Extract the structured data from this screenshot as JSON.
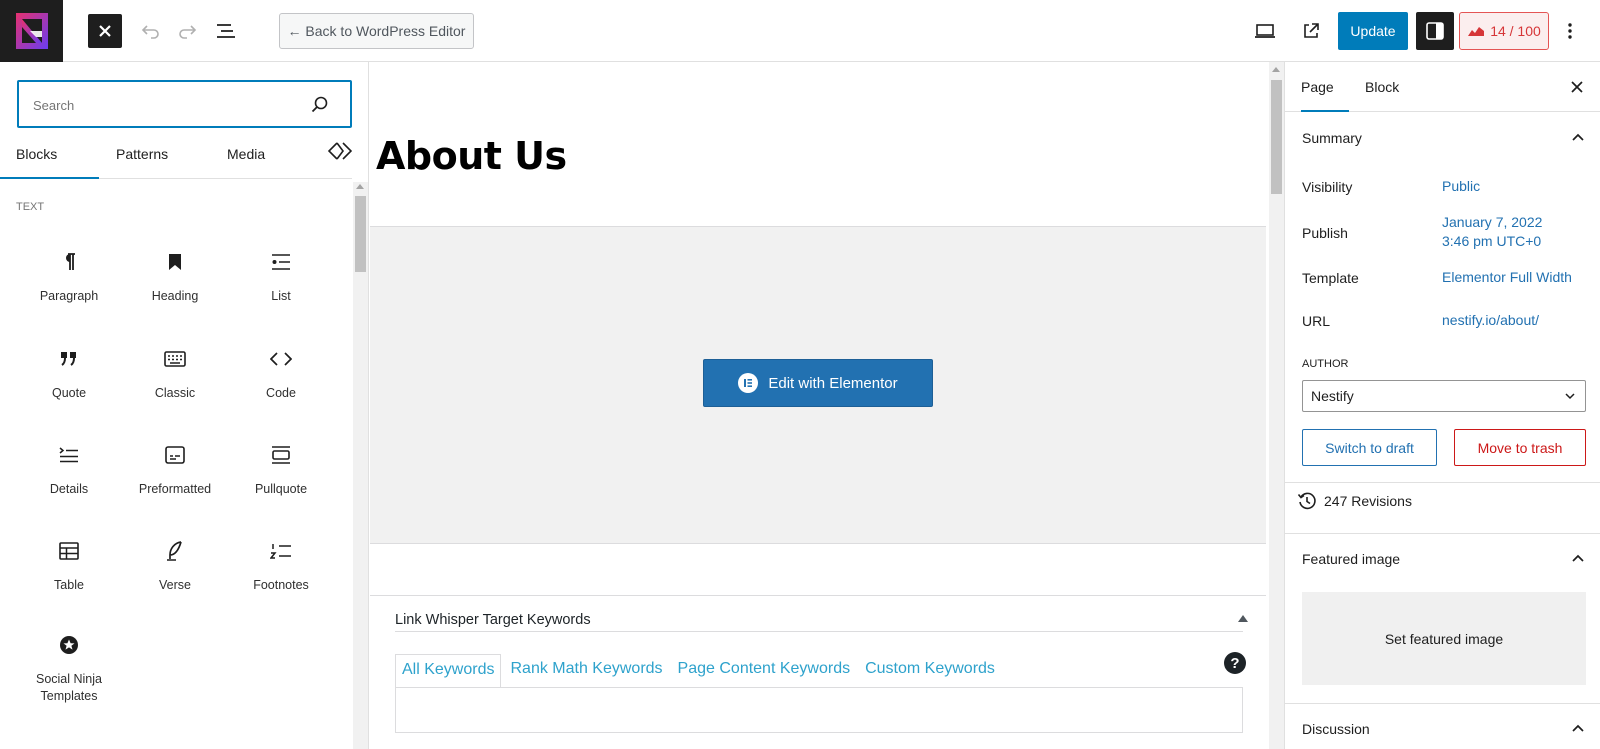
{
  "topbar": {
    "back_label": "← Back to WordPress Editor",
    "update_label": "Update",
    "score_label": "14 / 100",
    "colors": {
      "primary": "#007cba",
      "dark": "#1e1e1e",
      "score_red": "#d63638"
    }
  },
  "inserter": {
    "search_placeholder": "Search",
    "tabs": {
      "blocks": "Blocks",
      "patterns": "Patterns",
      "media": "Media"
    },
    "category": "TEXT",
    "blocks": [
      {
        "label": "Paragraph",
        "icon": "paragraph-icon"
      },
      {
        "label": "Heading",
        "icon": "heading-icon"
      },
      {
        "label": "List",
        "icon": "list-icon"
      },
      {
        "label": "Quote",
        "icon": "quote-icon"
      },
      {
        "label": "Classic",
        "icon": "classic-icon"
      },
      {
        "label": "Code",
        "icon": "code-icon"
      },
      {
        "label": "Details",
        "icon": "details-icon"
      },
      {
        "label": "Preformatted",
        "icon": "preformatted-icon"
      },
      {
        "label": "Pullquote",
        "icon": "pullquote-icon"
      },
      {
        "label": "Table",
        "icon": "table-icon"
      },
      {
        "label": "Verse",
        "icon": "verse-icon"
      },
      {
        "label": "Footnotes",
        "icon": "footnotes-icon"
      },
      {
        "label": "Social Ninja Templates",
        "icon": "social-ninja-icon"
      }
    ]
  },
  "canvas": {
    "title": "About Us",
    "elementor_button": "Edit with Elementor",
    "link_whisper": {
      "title": "Link Whisper Target Keywords",
      "help": "?",
      "tabs": [
        "All Keywords",
        "Rank Math Keywords",
        "Page Content Keywords",
        "Custom Keywords"
      ]
    }
  },
  "sidebar": {
    "tabs": {
      "page": "Page",
      "block": "Block"
    },
    "summary": {
      "heading": "Summary",
      "visibility_label": "Visibility",
      "visibility_value": "Public",
      "publish_label": "Publish",
      "publish_date": "January 7, 2022",
      "publish_time": "3:46 pm UTC+0",
      "template_label": "Template",
      "template_value": "Elementor Full Width",
      "url_label": "URL",
      "url_value": "nestify.io/about/",
      "author_label": "AUTHOR",
      "author_value": "Nestify",
      "draft_label": "Switch to draft",
      "trash_label": "Move to trash"
    },
    "revisions": "247 Revisions",
    "featured_image": {
      "heading": "Featured image",
      "button": "Set featured image"
    },
    "discussion": {
      "heading": "Discussion"
    }
  }
}
